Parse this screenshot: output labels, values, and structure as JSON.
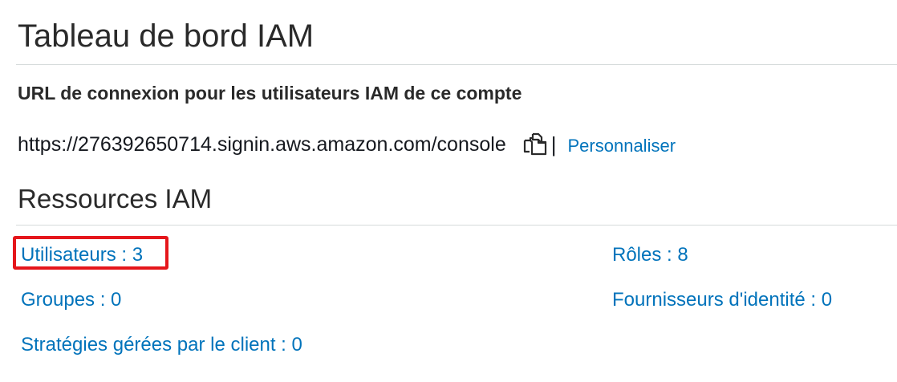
{
  "page": {
    "title": "Tableau de bord IAM"
  },
  "signin": {
    "heading": "URL de connexion pour les utilisateurs IAM de ce compte",
    "url": "https://276392650714.signin.aws.amazon.com/console",
    "separator": "|",
    "customize_label": "Personnaliser",
    "copy_icon": "copy-icon"
  },
  "resources": {
    "title": "Ressources IAM",
    "users_label": "Utilisateurs : 3",
    "roles_label": "Rôles : 8",
    "groups_label": "Groupes : 0",
    "identity_providers_label": "Fournisseurs d'identité : 0",
    "customer_managed_policies_label": "Stratégies gérées par le client : 0"
  },
  "colors": {
    "link": "#0073bb",
    "highlight": "#e5161b",
    "divider": "#d5dbdb",
    "text": "#16191f"
  }
}
